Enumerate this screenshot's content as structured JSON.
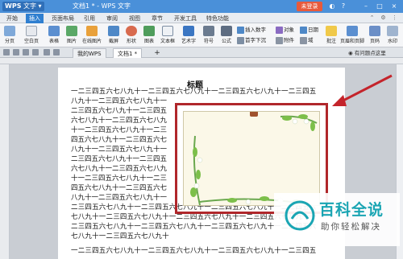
{
  "app": {
    "badge": "WPS",
    "name": "文字",
    "window_title": "文档1 * - WPS 文字",
    "login": "未登录"
  },
  "menu": {
    "tabs": [
      "开始",
      "插入",
      "页面布局",
      "引用",
      "审阅",
      "视图",
      "章节",
      "开发工具",
      "特色功能"
    ],
    "active": "插入"
  },
  "ribbon": {
    "items": [
      "分页",
      "空白页",
      "表格",
      "图片",
      "在线图片",
      "截屏",
      "形状",
      "图表",
      "文本框",
      "艺术字",
      "符号",
      "公式",
      "插入数字",
      "对象",
      "日期",
      "首字下沉",
      "附件",
      "域",
      "批注",
      "页眉和页脚",
      "页码",
      "水印"
    ]
  },
  "doctabs": [
    "我的WPS",
    "文档1 *"
  ],
  "taskpane": "有问题点这里",
  "document": {
    "title": "标题",
    "lines": [
      "一二三四五六七八九十一二三四五六七八九十一二三四五六七八九十一二三四五",
      "八九十一二三四五六七八九十一",
      "二三四五六七八九十一二三四五",
      "六七八九十一二三四五六七八九",
      "十一二三四五六七八九十一二三",
      "四五六七八九十一二三四五六七",
      "八九十一二三四五六七八九十一",
      "二三四五六七八九十一二三四五",
      "六七八九十一二三四五六七八九",
      "十一二三四五六七八九十一二三",
      "四五六七八九十一二三四五六七",
      "八九十一二三四五六七八九十一",
      "二三四五六七八九十一二三四五六七八九十一二三四五六七八九十一二三四五六",
      "七八九十一二三四五六七八九十一二三四五六七八九十一二三四五六七八九十一",
      "二三四五六七八九十一二三四五六七八九十一二三四五六七八九十一二三四五六",
      "七八九十一二三四五六七八九十",
      "一二三四五六七八九十一二三四五六七八九十一二三四五六七八九十一二三四五"
    ]
  },
  "watermark": {
    "title": "百科全说",
    "subtitle": "助你轻松解决"
  },
  "colors": {
    "titlebar": "#4a90d9",
    "accent": "#2f7fd0",
    "frame": "#b0272b",
    "arrow": "#c4242b",
    "watermark": "#1aa5b3"
  }
}
